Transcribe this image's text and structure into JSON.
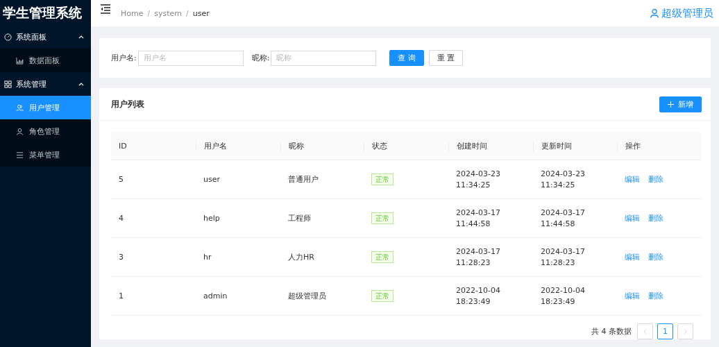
{
  "app_title": "学生管理系统",
  "sidebar": {
    "groups": [
      {
        "label": "系统面板",
        "kind": "gauge",
        "expanded": true,
        "children": [
          {
            "label": "数据面板",
            "kind": "chart",
            "selected": false
          }
        ]
      },
      {
        "label": "系统管理",
        "kind": "grid",
        "expanded": true,
        "children": [
          {
            "label": "用户管理",
            "kind": "users",
            "selected": true
          },
          {
            "label": "角色管理",
            "kind": "user",
            "selected": false
          },
          {
            "label": "菜单管理",
            "kind": "list",
            "selected": false
          }
        ]
      }
    ]
  },
  "breadcrumb": {
    "items": [
      "Home",
      "system",
      "user"
    ],
    "separator": "/"
  },
  "user_name": "超级管理员",
  "search": {
    "fields": [
      {
        "label": "用户名:",
        "placeholder": "用户名"
      },
      {
        "label": "昵称:",
        "placeholder": "昵称"
      }
    ],
    "buttons": [
      {
        "label": "查 询",
        "kind": "primary"
      },
      {
        "label": "重 置",
        "kind": "default"
      }
    ]
  },
  "list": {
    "title": "用户列表",
    "add_button": "新增",
    "columns": [
      "ID",
      "用户名",
      "昵称",
      "状态",
      "创建时间",
      "更新时间",
      "操作"
    ],
    "rows": [
      {
        "id": "5",
        "username": "user",
        "nickname": "普通用户",
        "status": "正常",
        "created": [
          "2024-03-23",
          "11:34:25"
        ],
        "updated": [
          "2024-03-23",
          "11:34:25"
        ],
        "actions": [
          "编辑",
          "删除"
        ]
      },
      {
        "id": "4",
        "username": "help",
        "nickname": "工程师",
        "status": "正常",
        "created": [
          "2024-03-17",
          "11:44:58"
        ],
        "updated": [
          "2024-03-17",
          "11:44:58"
        ],
        "actions": [
          "编辑",
          "删除"
        ]
      },
      {
        "id": "3",
        "username": "hr",
        "nickname": "人力HR",
        "status": "正常",
        "created": [
          "2024-03-17",
          "11:28:23"
        ],
        "updated": [
          "2024-03-17",
          "11:28:23"
        ],
        "actions": [
          "编辑",
          "删除"
        ]
      },
      {
        "id": "1",
        "username": "admin",
        "nickname": "超级管理员",
        "status": "正常",
        "created": [
          "2022-10-04",
          "18:23:49"
        ],
        "updated": [
          "2022-10-04",
          "18:23:49"
        ],
        "actions": [
          "编辑",
          "删除"
        ]
      }
    ]
  },
  "pagination": {
    "total": "共 4 条数据",
    "pages": [
      {
        "label": "1",
        "selected": true
      }
    ],
    "prev_disabled": true,
    "next_disabled": true
  }
}
